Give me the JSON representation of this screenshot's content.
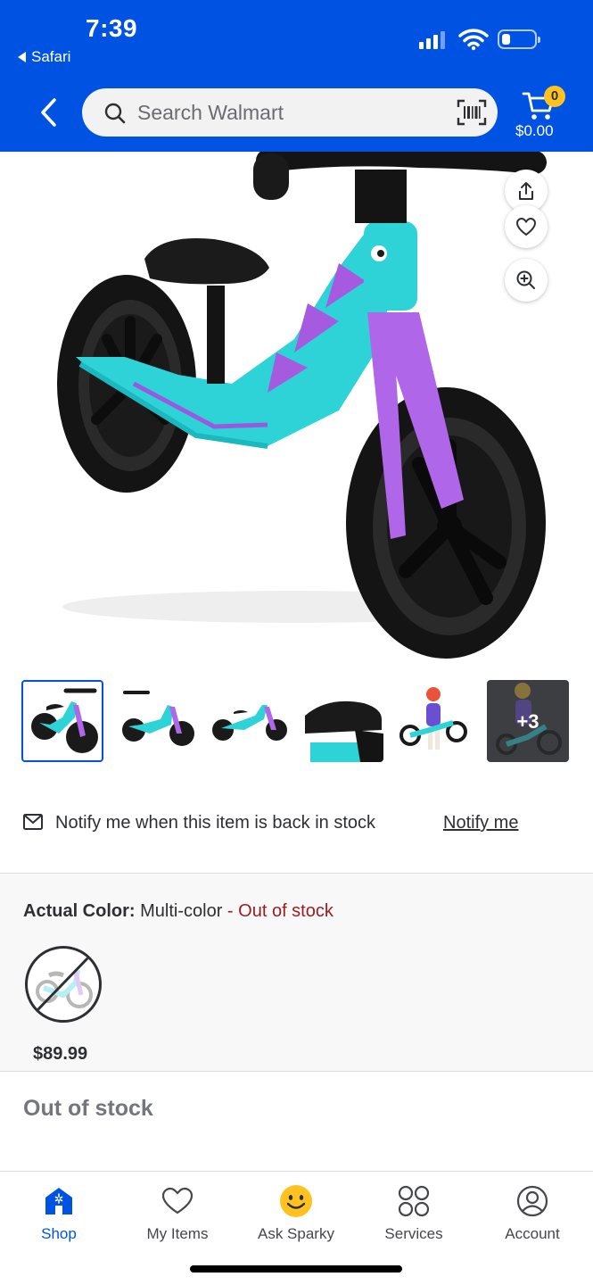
{
  "status_bar": {
    "time": "7:39",
    "back_app": "Safari"
  },
  "header": {
    "search_placeholder": "Search Walmart",
    "cart_count": "0",
    "cart_total": "$0.00",
    "icons": [
      "back-arrow-icon",
      "search-icon",
      "barcode-scan-icon",
      "cart-icon"
    ]
  },
  "product_image": {
    "actions": [
      "share-icon",
      "heart-icon",
      "zoom-in-icon"
    ]
  },
  "thumbnails": {
    "selected_index": 0,
    "more_label": "+3",
    "count_shown": 6
  },
  "notify": {
    "message": "Notify me when this item is back in stock",
    "link_label": "Notify me"
  },
  "variant": {
    "label": "Actual Color:",
    "value": "Multi-color",
    "status": " - Out of stock",
    "swatch_price": "$89.99"
  },
  "availability": {
    "title": "Out of stock"
  },
  "bottom_nav": {
    "items": [
      {
        "label": "Shop",
        "icon": "shop-icon",
        "active": true
      },
      {
        "label": "My Items",
        "icon": "heart-icon",
        "active": false
      },
      {
        "label": "Ask Sparky",
        "icon": "sparky-icon",
        "active": false
      },
      {
        "label": "Services",
        "icon": "services-grid-icon",
        "active": false
      },
      {
        "label": "Account",
        "icon": "account-icon",
        "active": false
      }
    ]
  },
  "colors": {
    "brand_blue": "#0053e2",
    "spark_yellow": "#ffc220",
    "out_of_stock_red": "#9b1c1f",
    "bike_teal": "#2ed3d8",
    "bike_purple": "#b066e8"
  }
}
